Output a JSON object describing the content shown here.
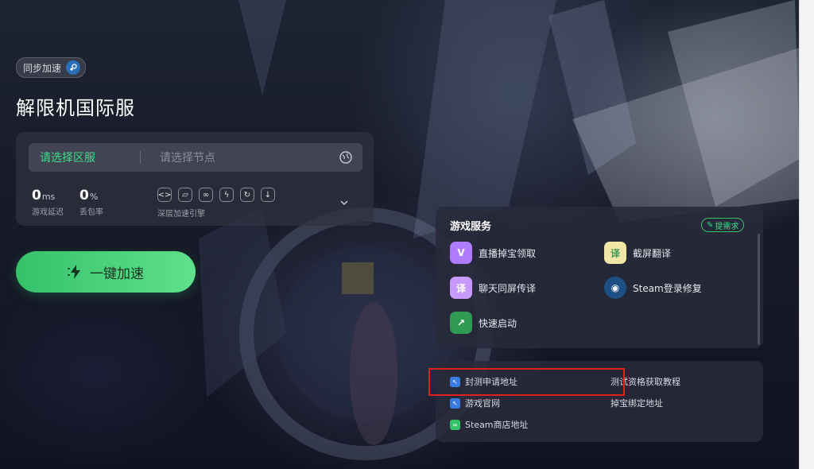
{
  "header": {
    "sync_label": "同步加速",
    "title": "解限机国际服"
  },
  "selector": {
    "region_label": "请选择区服",
    "node_label": "请选择节点"
  },
  "stats": [
    {
      "value": "0",
      "unit": "ms",
      "label": "游戏延迟"
    },
    {
      "value": "0",
      "unit": "%",
      "label": "丢包率"
    }
  ],
  "engine": {
    "label": "深层加速引擎"
  },
  "boost_button": {
    "label": "一键加速"
  },
  "services": {
    "title": "游戏服务",
    "request_label": "提需求",
    "items": [
      {
        "label": "直播掉宝领取",
        "icon": "gift-icon"
      },
      {
        "label": "截屏翻译",
        "icon": "translate-icon"
      },
      {
        "label": "聊天同屏传译",
        "icon": "chat-translate-icon"
      },
      {
        "label": "Steam登录修复",
        "icon": "steam-icon"
      },
      {
        "label": "快速启动",
        "icon": "quick-launch-icon"
      }
    ]
  },
  "links": [
    {
      "label": "封测申请地址"
    },
    {
      "label": "测试资格获取教程"
    },
    {
      "label": "游戏官网"
    },
    {
      "label": "掉宝绑定地址"
    },
    {
      "label": "Steam商店地址"
    }
  ],
  "colors": {
    "accent": "#3fdc8a",
    "button_start": "#35c26a",
    "button_end": "#5fe08c",
    "highlight": "#e02020"
  }
}
